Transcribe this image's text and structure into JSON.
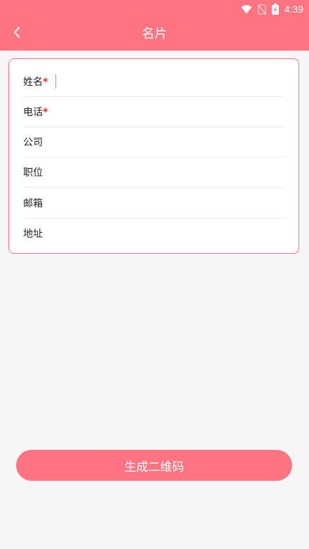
{
  "status_bar": {
    "time": "4:39",
    "icons": [
      "wifi-icon",
      "no-sim-icon",
      "battery-charging-icon"
    ]
  },
  "header": {
    "title": "名片",
    "back_icon": "chevron-left-icon"
  },
  "form": {
    "fields": [
      {
        "label": "姓名",
        "required": "*",
        "value": ""
      },
      {
        "label": "电话",
        "required": "*",
        "value": ""
      },
      {
        "label": "公司",
        "value": ""
      },
      {
        "label": "职位",
        "value": ""
      },
      {
        "label": "邮箱",
        "value": ""
      },
      {
        "label": "地址",
        "value": ""
      }
    ]
  },
  "actions": {
    "generate_label": "生成二维码"
  },
  "colors": {
    "accent": "#ff7480",
    "background": "#f6f6f7",
    "required": "#e63030"
  }
}
